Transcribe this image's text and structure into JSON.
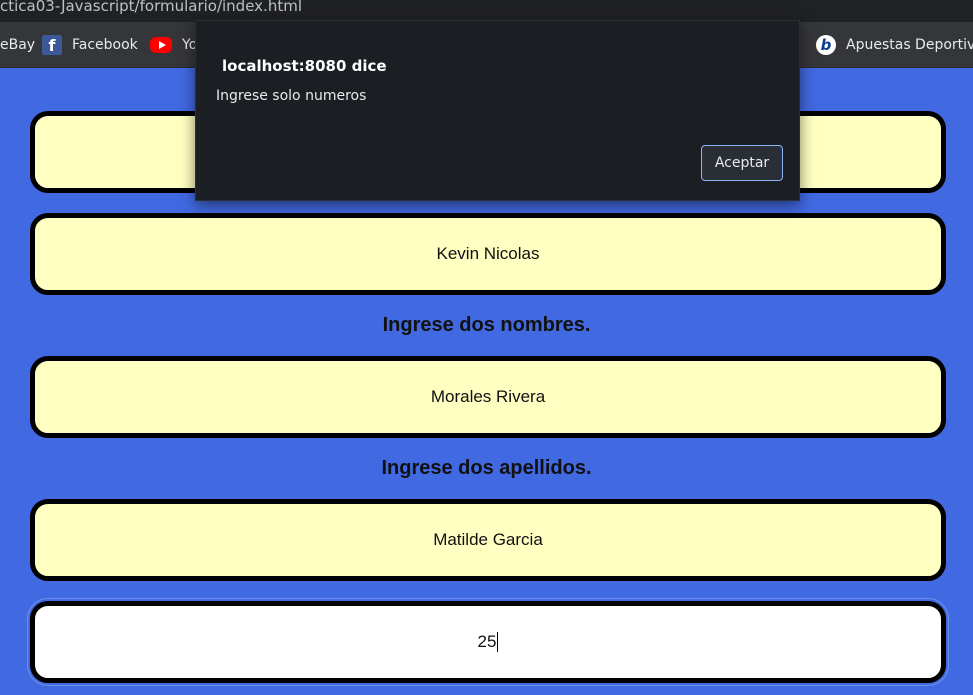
{
  "browser": {
    "url_text": "ctica03-Javascript/formulario/index.html",
    "bookmarks": [
      {
        "label": "eBay"
      },
      {
        "label": "Facebook",
        "icon": "facebook-icon"
      },
      {
        "label": "Yo",
        "icon": "youtube-icon"
      },
      {
        "label": "Apuestas Deportiva",
        "icon": "betting-site-icon"
      }
    ]
  },
  "dialog": {
    "title": "localhost:8080 dice",
    "message": "Ingrese solo numeros",
    "button_label": "Aceptar"
  },
  "form": {
    "field1_value": "",
    "field2_value": "Kevin Nicolas",
    "label_nombres": "Ingrese dos nombres.",
    "field3_value": "Morales Rivera",
    "label_apellidos": "Ingrese dos apellidos.",
    "field4_value": "Matilde Garcia",
    "field5_value": "25"
  },
  "colors": {
    "page_background": "#4169e1",
    "field_background": "#ffffc2",
    "dialog_background": "#1b1e22"
  }
}
